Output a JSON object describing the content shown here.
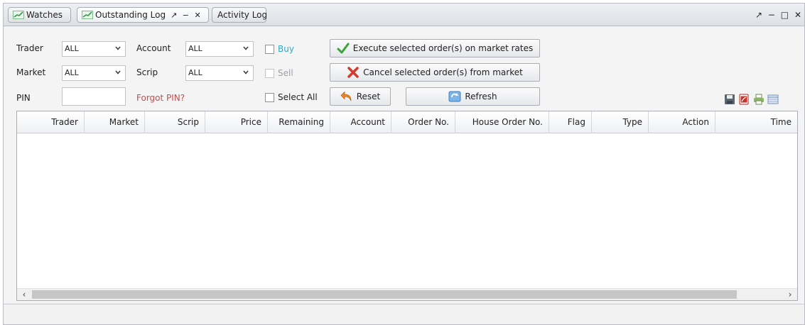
{
  "tabs": [
    {
      "label": "Watches"
    },
    {
      "label": "Outstanding Log",
      "controls": "↗ − ✕"
    },
    {
      "label": "Activity Log"
    }
  ],
  "window_controls": "↗ − □ ✕",
  "form": {
    "trader_label": "Trader",
    "trader_value": "ALL",
    "market_label": "Market",
    "market_value": "ALL",
    "account_label": "Account",
    "account_value": "ALL",
    "scrip_label": "Scrip",
    "scrip_value": "ALL",
    "pin_label": "PIN",
    "pin_value": "",
    "forgot_pin": "Forgot PIN?",
    "buy_label": "Buy",
    "sell_label": "Sell",
    "select_all_label": "Select All",
    "execute_button": "Execute selected order(s) on market rates",
    "cancel_button": "Cancel selected order(s) from market",
    "reset_button": "Reset",
    "refresh_button": "Refresh"
  },
  "toolbar_icons": [
    "save-icon",
    "pdf-icon",
    "print-icon",
    "columns-icon"
  ],
  "grid": {
    "columns": [
      "Trader",
      "Market",
      "Scrip",
      "Price",
      "Remaining",
      "Account",
      "Order No.",
      "House Order No.",
      "Flag",
      "Type",
      "Action",
      "Time"
    ],
    "rows": []
  },
  "colors": {
    "buy": "#2aa9c9",
    "sell": "#9aa0a6",
    "forgot_pin": "#c0504d",
    "tab_icon": "#3aa655"
  }
}
